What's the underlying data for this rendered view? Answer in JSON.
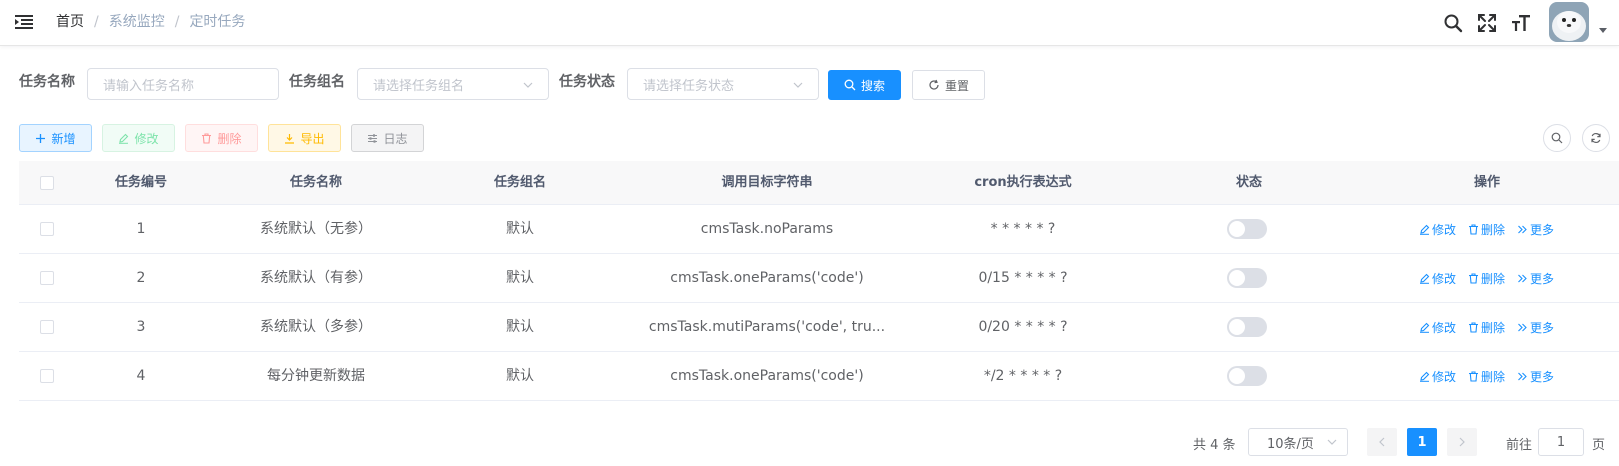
{
  "navbar": {
    "breadcrumb": [
      "首页",
      "系统监控",
      "定时任务"
    ]
  },
  "search": {
    "job_name_label": "任务名称",
    "job_name_placeholder": "请输入任务名称",
    "job_group_label": "任务组名",
    "job_group_placeholder": "请选择任务组名",
    "job_status_label": "任务状态",
    "job_status_placeholder": "请选择任务状态",
    "search_button": "搜索",
    "reset_button": "重置"
  },
  "toolbar": {
    "add": "新增",
    "edit": "修改",
    "delete": "删除",
    "export": "导出",
    "log": "日志"
  },
  "table": {
    "columns": [
      "任务编号",
      "任务名称",
      "任务组名",
      "调用目标字符串",
      "cron执行表达式",
      "状态",
      "操作"
    ],
    "rows": [
      {
        "id": "1",
        "name": "系统默认（无参）",
        "group": "默认",
        "target": "cmsTask.noParams",
        "cron": "* * * * * ?",
        "status_on": false
      },
      {
        "id": "2",
        "name": "系统默认（有参）",
        "group": "默认",
        "target": "cmsTask.oneParams('code')",
        "cron": "0/15 * * * * ?",
        "status_on": false
      },
      {
        "id": "3",
        "name": "系统默认（多参）",
        "group": "默认",
        "target": "cmsTask.mutiParams('code', tru...",
        "cron": "0/20 * * * * ?",
        "status_on": false
      },
      {
        "id": "4",
        "name": "每分钟更新数据",
        "group": "默认",
        "target": "cmsTask.oneParams('code')",
        "cron": "*/2 * * * * ?",
        "status_on": false
      }
    ],
    "row_actions": {
      "edit": "修改",
      "delete": "删除",
      "more": "更多"
    }
  },
  "pagination": {
    "total_text": "共 4 条",
    "page_size": "10条/页",
    "current_page": "1",
    "goto_label": "前往",
    "goto_value": "1",
    "page_suffix": "页"
  },
  "colors": {
    "primary": "#1890ff",
    "success": "#13ce66",
    "danger": "#ff4949",
    "warning": "#ffba00",
    "info": "#909399"
  }
}
